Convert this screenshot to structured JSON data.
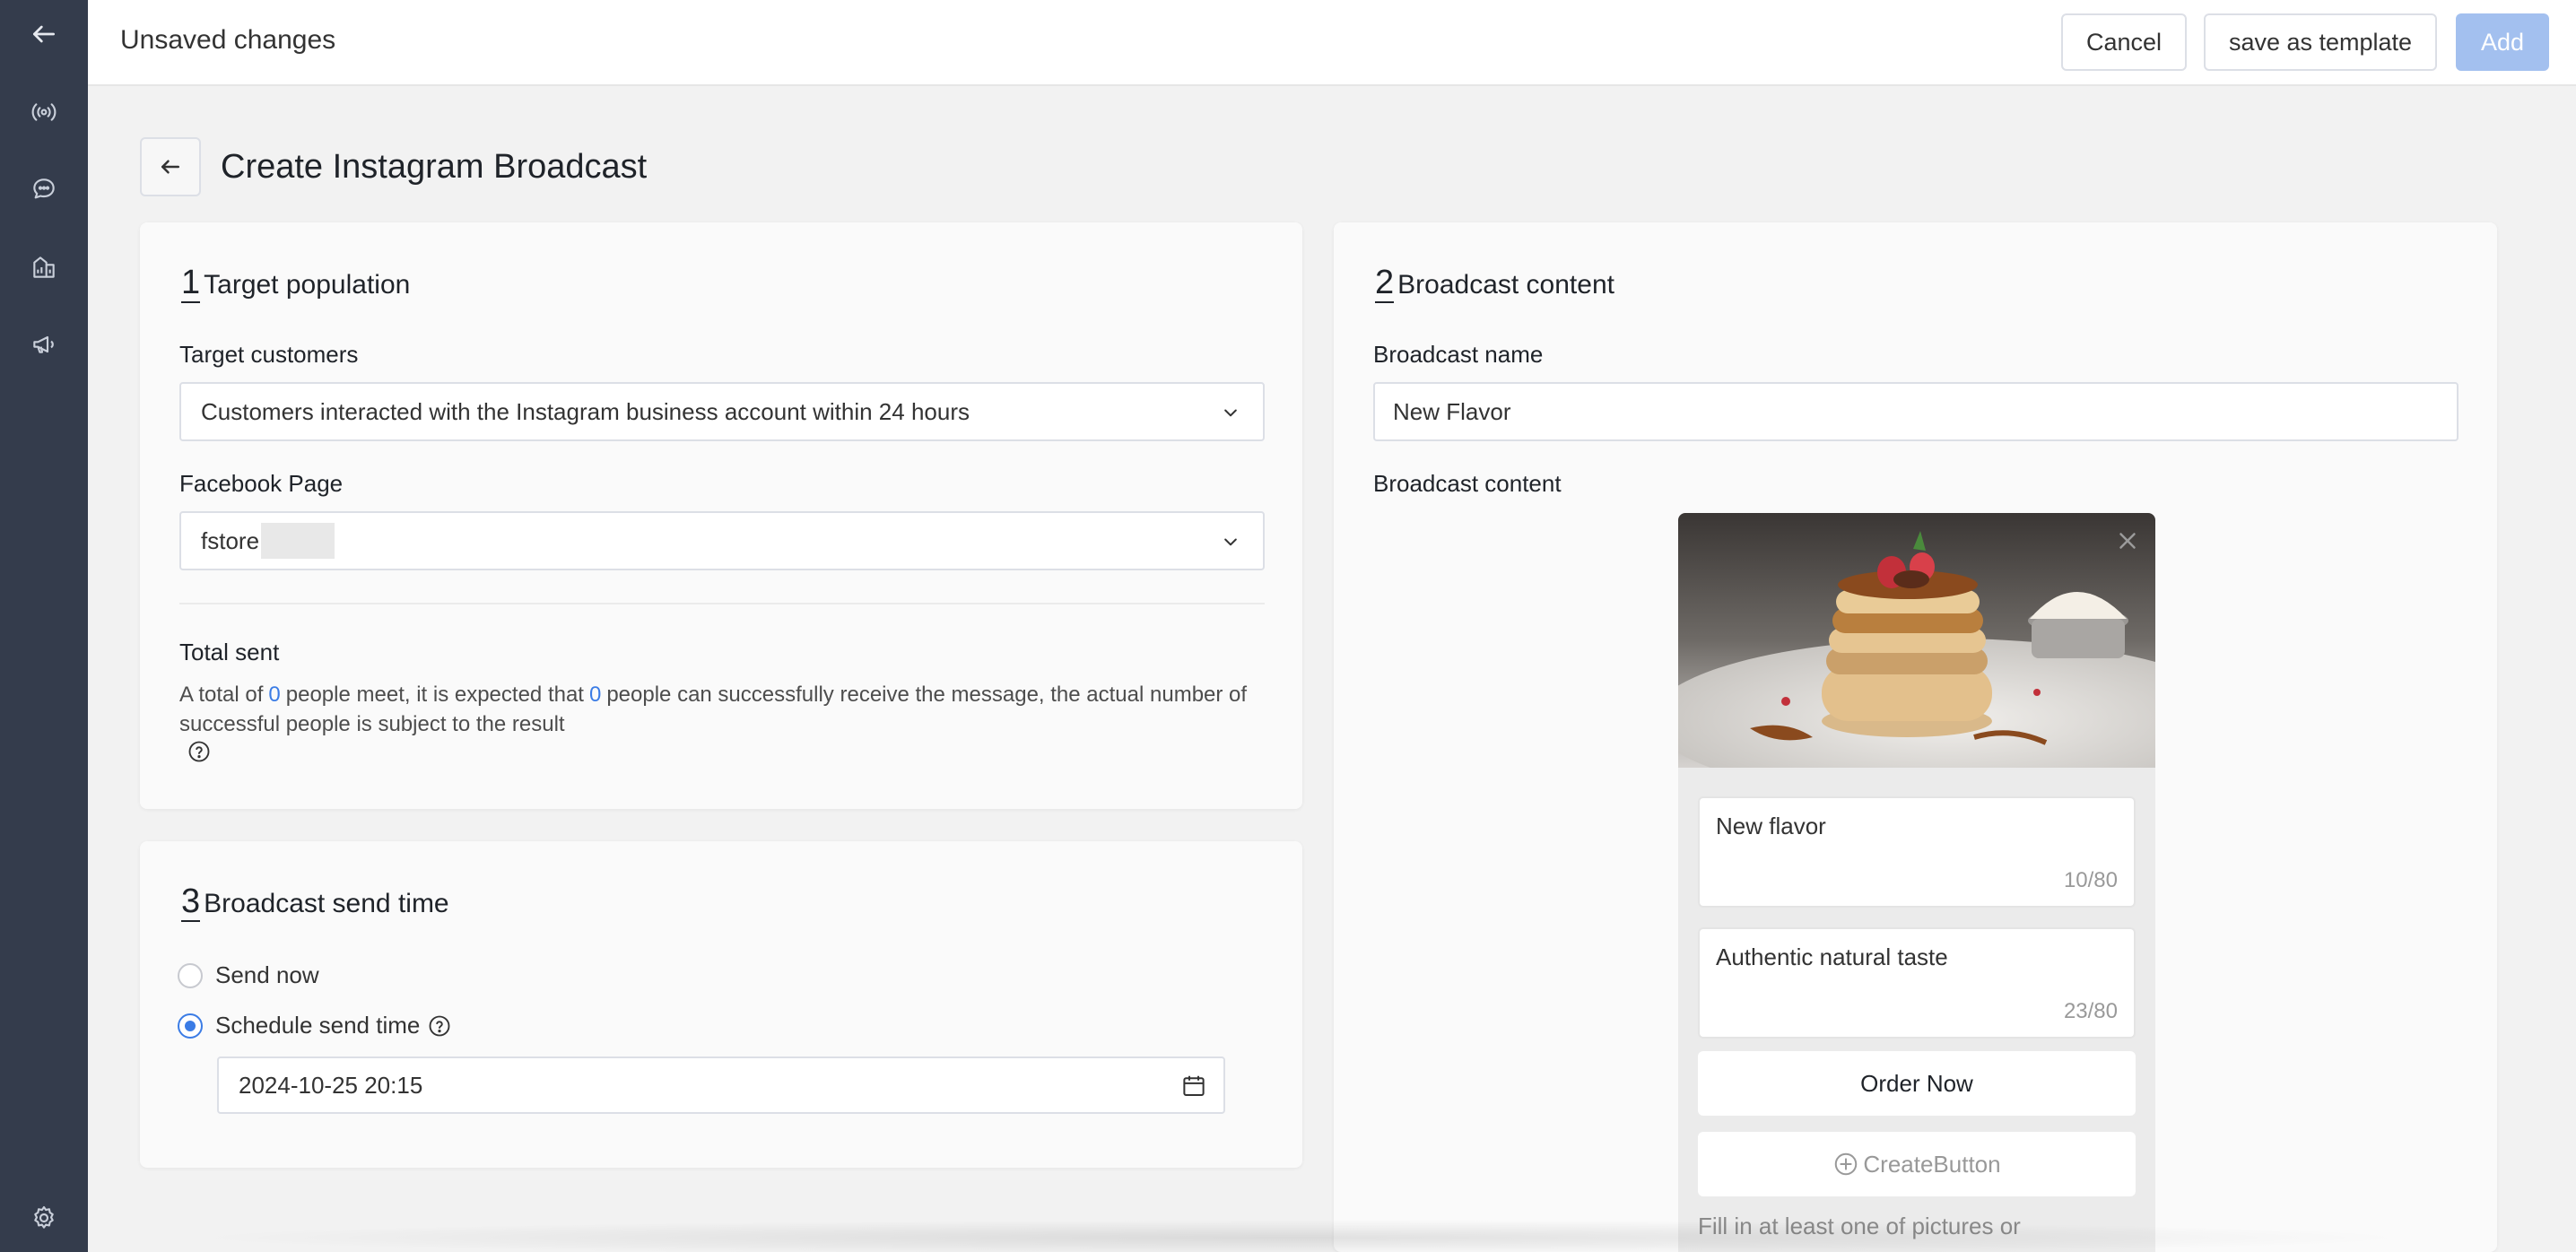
{
  "header": {
    "title": "Unsaved changes",
    "cancel_label": "Cancel",
    "template_label": "save as template",
    "add_label": "Add"
  },
  "page": {
    "title": "Create Instagram Broadcast"
  },
  "target": {
    "num": "1",
    "title": "Target population",
    "customers_label": "Target customers",
    "customers_value": "Customers interacted with the Instagram business account within 24 hours",
    "page_label": "Facebook Page",
    "page_value": "fstore",
    "total_label": "Total sent",
    "total_prefix": "A total of",
    "people_meet": "0",
    "total_middle": "people meet, it is expected that",
    "people_receive": "0",
    "total_suffix": "people can successfully receive the message, the actual number of successful people is subject to the result"
  },
  "send_time": {
    "num": "3",
    "title": "Broadcast send time",
    "send_now_label": "Send now",
    "schedule_label": "Schedule send time",
    "selected": "schedule",
    "datetime_value": "2024-10-25 20:15"
  },
  "content": {
    "num": "2",
    "title": "Broadcast content",
    "name_label": "Broadcast name",
    "name_value": "New Flavor",
    "content_label": "Broadcast content",
    "preview": {
      "title_text": "New flavor",
      "title_count": "10/80",
      "subtitle_text": "Authentic natural taste",
      "subtitle_count": "23/80",
      "button_label": "Order Now",
      "create_button_label": "CreateButton",
      "hint": "Fill in at least one of pictures or"
    }
  },
  "colors": {
    "sidebar_bg": "#343c4c",
    "accent": "#3b7ce5",
    "add_disabled": "#a3c0ef"
  },
  "icons": {
    "sidebar": [
      "back-arrow-icon",
      "broadcast-icon",
      "chat-icon",
      "analytics-icon",
      "megaphone-icon",
      "settings-gear-icon"
    ]
  }
}
